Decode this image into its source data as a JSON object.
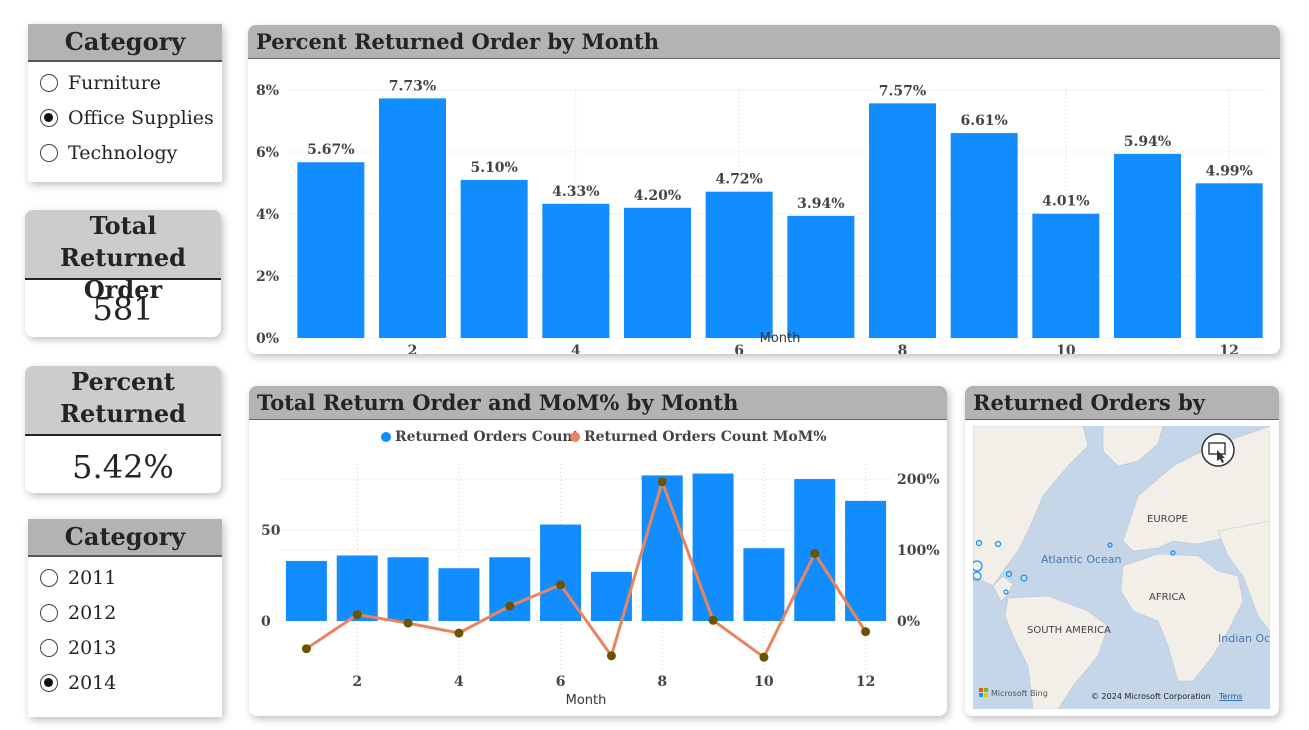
{
  "slicer_category": {
    "title": "Category",
    "options": [
      {
        "label": "Furniture",
        "selected": false
      },
      {
        "label": "Office Supplies",
        "selected": true
      },
      {
        "label": "Technology",
        "selected": false
      }
    ]
  },
  "kpi_total": {
    "title_line1": "Total Returned",
    "title_line2": "Order",
    "value": "581"
  },
  "kpi_percent": {
    "title_line1": "Percent",
    "title_line2": "Returned",
    "value": "5.42%"
  },
  "slicer_year": {
    "title": "Category",
    "options": [
      {
        "label": "2011",
        "selected": false
      },
      {
        "label": "2012",
        "selected": false
      },
      {
        "label": "2013",
        "selected": false
      },
      {
        "label": "2014",
        "selected": true
      }
    ]
  },
  "chart_data": [
    {
      "type": "bar",
      "title": "Percent Returned Order by Month",
      "xlabel": "Month",
      "ylabel": "",
      "categories": [
        1,
        2,
        3,
        4,
        5,
        6,
        7,
        8,
        9,
        10,
        11,
        12
      ],
      "values": [
        5.67,
        7.73,
        5.1,
        4.33,
        4.2,
        4.72,
        3.94,
        7.57,
        6.61,
        4.01,
        5.94,
        4.99
      ],
      "data_labels": [
        "5.67%",
        "7.73%",
        "5.10%",
        "4.33%",
        "4.20%",
        "4.72%",
        "3.94%",
        "7.57%",
        "6.61%",
        "4.01%",
        "5.94%",
        "4.99%"
      ],
      "x_ticks": [
        "2",
        "4",
        "6",
        "8",
        "10",
        "12"
      ],
      "y_ticks": [
        "0%",
        "2%",
        "4%",
        "6%",
        "8%"
      ],
      "ylim": [
        0,
        8
      ],
      "bar_color": "#118DFF",
      "grid": true
    },
    {
      "type": "bar+line",
      "title": "Total Return Order and MoM% by Month",
      "xlabel": "Month",
      "categories": [
        1,
        2,
        3,
        4,
        5,
        6,
        7,
        8,
        9,
        10,
        11,
        12
      ],
      "series": [
        {
          "name": "Returned Orders Count",
          "kind": "bar",
          "axis": "left",
          "color": "#118DFF",
          "values": [
            33,
            36,
            35,
            29,
            35,
            53,
            27,
            80,
            81,
            40,
            78,
            66
          ]
        },
        {
          "name": "Returned Orders Count MoM%",
          "kind": "line",
          "axis": "right",
          "color": "#E8855F",
          "values": [
            -39,
            9,
            -3,
            -17,
            21,
            51,
            -49,
            196,
            1,
            -51,
            95,
            -15
          ]
        }
      ],
      "x_ticks": [
        "2",
        "4",
        "6",
        "8",
        "10",
        "12"
      ],
      "y_left_ticks": [
        "0",
        "50"
      ],
      "y_right_ticks": [
        "0%",
        "100%",
        "200%"
      ],
      "ylim_left": [
        0,
        100
      ],
      "ylim_right": [
        0,
        200
      ],
      "legend_position": "top-center",
      "marker_color": "#6B5300",
      "grid": true
    }
  ],
  "map": {
    "title": "Returned Orders by Country",
    "labels": {
      "europe": "EUROPE",
      "atlantic": "Atlantic Ocean",
      "africa": "AFRICA",
      "south_america": "SOUTH AMERICA",
      "indian": "Indian Oce"
    },
    "footer_brand": "Microsoft Bing",
    "copyright": "© 2024 Microsoft Corporation",
    "terms": "Terms",
    "focus_icon": "focus-mode-icon"
  }
}
